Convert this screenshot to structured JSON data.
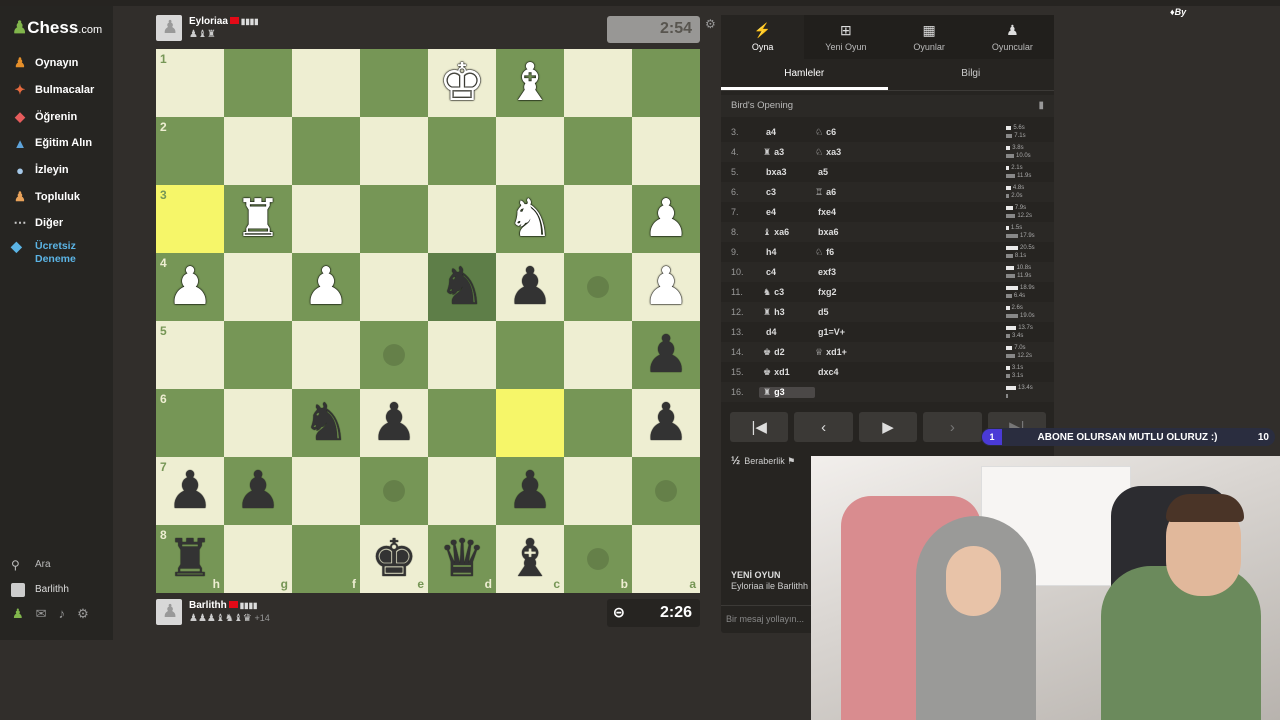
{
  "sidebar": {
    "logo": "Chess",
    "logo_suffix": ".com",
    "items": [
      {
        "label": "Oynayın",
        "icon": "play-icon"
      },
      {
        "label": "Bulmacalar",
        "icon": "puzzle-icon"
      },
      {
        "label": "Öğrenin",
        "icon": "learn-icon"
      },
      {
        "label": "Eğitim Alın",
        "icon": "graduation-cap-icon"
      },
      {
        "label": "İzleyin",
        "icon": "binoculars-icon"
      },
      {
        "label": "Topluluk",
        "icon": "community-icon"
      },
      {
        "label": "Diğer",
        "icon": "more-dots-icon"
      }
    ],
    "trial_label": "Ücretsiz Deneme",
    "search_label": "Ara",
    "user_label": "Barlithh"
  },
  "top_player": {
    "name": "Eyloriaa",
    "bars": "▮▮▮▮",
    "captured": "♟♝♜",
    "clock": "2:54"
  },
  "bottom_player": {
    "name": "Barlithh",
    "bars": "▮▮▮▮",
    "captured": "♟♟♟♝♞♝♛",
    "advantage": "+14",
    "clock": "2:26"
  },
  "board": {
    "ranks": [
      "1",
      "2",
      "3",
      "4",
      "5",
      "6",
      "7",
      "8"
    ],
    "files": [
      "h",
      "g",
      "f",
      "e",
      "d",
      "c",
      "b",
      "a"
    ],
    "pieces": [
      [
        "",
        "",
        "",
        "",
        "wK",
        "wB",
        "",
        ""
      ],
      [
        "",
        "",
        "",
        "",
        "",
        "",
        "",
        ""
      ],
      [
        "",
        "wR",
        "",
        "",
        "",
        "wN",
        "",
        "wP"
      ],
      [
        "wP",
        "",
        "wP",
        "",
        "bN",
        "bP",
        "",
        "wP"
      ],
      [
        "",
        "",
        "",
        "",
        "",
        "",
        "",
        "bP"
      ],
      [
        "",
        "",
        "bN",
        "bP",
        "",
        "",
        "",
        "bP"
      ],
      [
        "bP",
        "bP",
        "",
        "",
        "",
        "bP",
        "",
        ""
      ],
      [
        "bR",
        "",
        "",
        "bK",
        "bQ",
        "bB",
        "",
        ""
      ]
    ],
    "highlights": [
      [
        2,
        0
      ],
      [
        5,
        5
      ]
    ],
    "selected": [
      [
        3,
        4
      ]
    ],
    "dots": [
      [
        3,
        6
      ],
      [
        4,
        3
      ],
      [
        6,
        3
      ],
      [
        6,
        7
      ],
      [
        7,
        6
      ]
    ]
  },
  "panel": {
    "tabs": [
      {
        "label": "Oyna",
        "icon": "bolt-icon"
      },
      {
        "label": "Yeni Oyun",
        "icon": "plus-square-icon"
      },
      {
        "label": "Oyunlar",
        "icon": "board-icon"
      },
      {
        "label": "Oyuncular",
        "icon": "players-icon"
      }
    ],
    "subtabs": [
      "Hamleler",
      "Bilgi"
    ],
    "opening": "Bird's Opening",
    "moves": [
      {
        "n": "3.",
        "wp": "",
        "w": "a4",
        "bp": "♘",
        "b": "c6",
        "t1": "5.6s",
        "t2": "7.1s"
      },
      {
        "n": "4.",
        "wp": "♜",
        "w": "a3",
        "bp": "♘",
        "b": "xa3",
        "t1": "3.8s",
        "t2": "10.0s"
      },
      {
        "n": "5.",
        "wp": "",
        "w": "bxa3",
        "bp": "",
        "b": "a5",
        "t1": "2.1s",
        "t2": "11.9s"
      },
      {
        "n": "6.",
        "wp": "",
        "w": "c3",
        "bp": "♖",
        "b": "a6",
        "t1": "4.8s",
        "t2": "2.0s"
      },
      {
        "n": "7.",
        "wp": "",
        "w": "e4",
        "bp": "",
        "b": "fxe4",
        "t1": "7.9s",
        "t2": "12.2s"
      },
      {
        "n": "8.",
        "wp": "♝",
        "w": "xa6",
        "bp": "",
        "b": "bxa6",
        "t1": "1.5s",
        "t2": "17.9s"
      },
      {
        "n": "9.",
        "wp": "",
        "w": "h4",
        "bp": "♘",
        "b": "f6",
        "t1": "20.5s",
        "t2": "8.1s"
      },
      {
        "n": "10.",
        "wp": "",
        "w": "c4",
        "bp": "",
        "b": "exf3",
        "t1": "10.8s",
        "t2": "11.9s"
      },
      {
        "n": "11.",
        "wp": "♞",
        "w": "c3",
        "bp": "",
        "b": "fxg2",
        "t1": "18.9s",
        "t2": "6.4s"
      },
      {
        "n": "12.",
        "wp": "♜",
        "w": "h3",
        "bp": "",
        "b": "d5",
        "t1": "2.6s",
        "t2": "19.0s"
      },
      {
        "n": "13.",
        "wp": "",
        "w": "d4",
        "bp": "",
        "b": "g1=V+",
        "t1": "13.7s",
        "t2": "3.4s"
      },
      {
        "n": "14.",
        "wp": "♚",
        "w": "d2",
        "bp": "♕",
        "b": "xd1+",
        "t1": "7.0s",
        "t2": "12.2s"
      },
      {
        "n": "15.",
        "wp": "♚",
        "w": "xd1",
        "bp": "",
        "b": "dxc4",
        "t1": "3.1s",
        "t2": "3.1s"
      },
      {
        "n": "16.",
        "wp": "♜",
        "w": "g3",
        "bp": "",
        "b": "",
        "t1": "13.4s",
        "t2": ""
      }
    ],
    "draw_label": "Beraberlik",
    "new_game_title": "YENİ OYUN",
    "new_game_sub": "Eyloriaa ile Barlithh",
    "chat_placeholder": "Bir mesaj yollayın..."
  },
  "overlay": {
    "banner_left": "1",
    "banner_text": "ABONE OLURSAN MUTLU OLURUZ :)",
    "banner_right": "10",
    "corner_logo": "By"
  },
  "colors": {
    "light_square": "#eeeed2",
    "dark_square": "#769656",
    "highlight": "#f6f669",
    "accent": "#81b64c"
  }
}
